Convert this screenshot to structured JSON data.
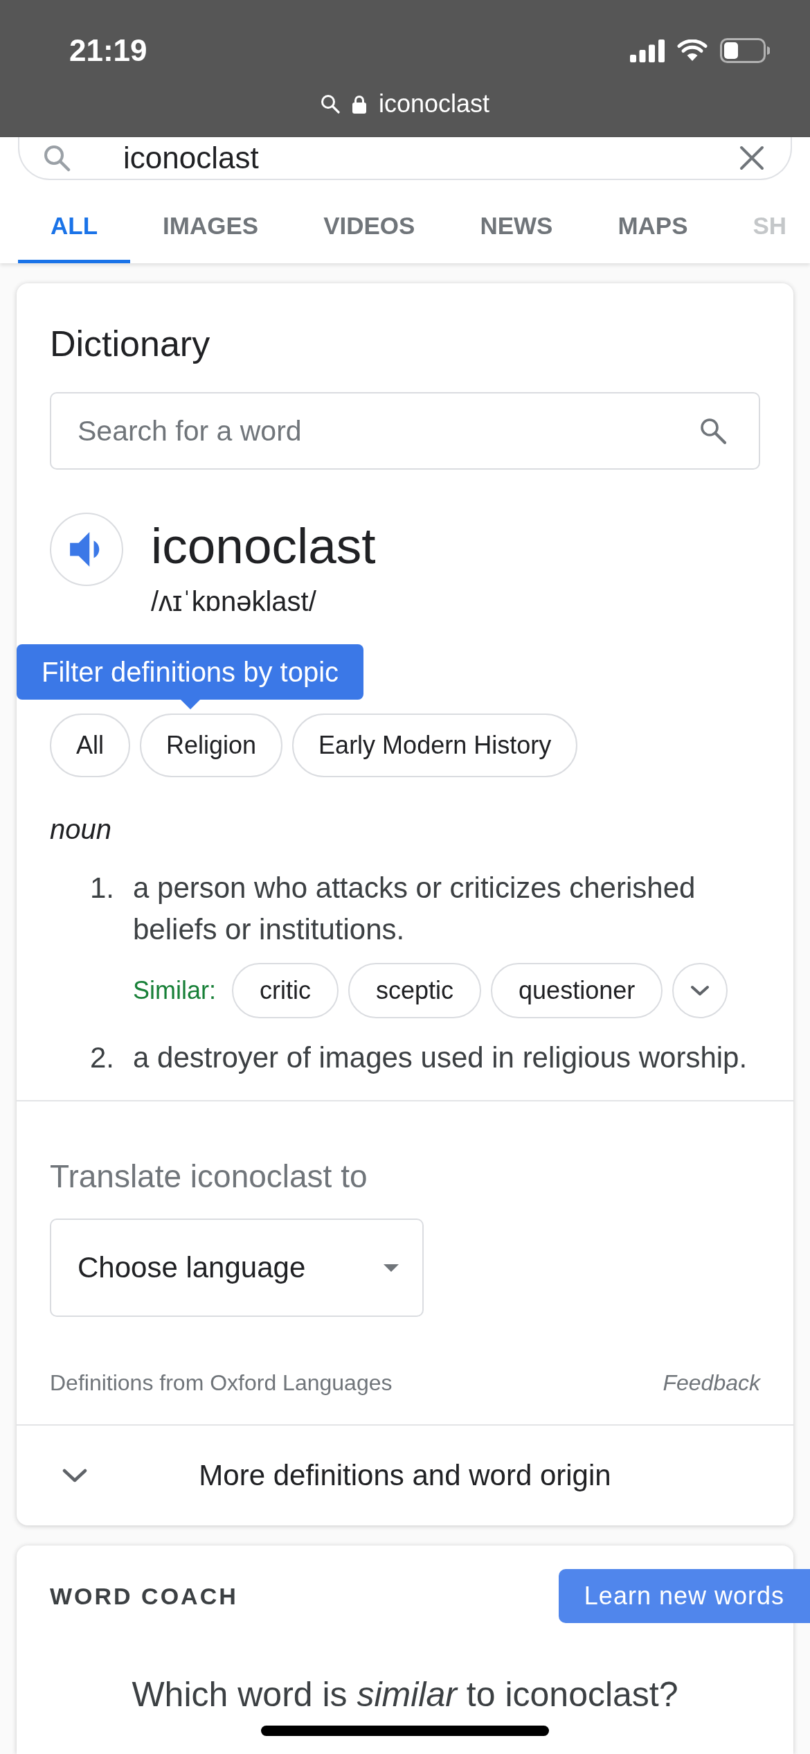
{
  "status_bar": {
    "time": "21:19"
  },
  "address_bar": {
    "url": "iconoclast"
  },
  "search": {
    "value": "iconoclast"
  },
  "tabs": [
    {
      "label": "ALL",
      "selected": true
    },
    {
      "label": "IMAGES",
      "selected": false
    },
    {
      "label": "VIDEOS",
      "selected": false
    },
    {
      "label": "NEWS",
      "selected": false
    },
    {
      "label": "MAPS",
      "selected": false
    },
    {
      "label": "SH",
      "selected": false
    }
  ],
  "dictionary": {
    "title": "Dictionary",
    "search": {
      "placeholder": "Search for a word"
    },
    "word": "iconoclast",
    "phonetic": "/ʌɪˈkɒnəklast/",
    "tooltip": "Filter definitions by topic",
    "topics": [
      "All",
      "Religion",
      "Early Modern History"
    ],
    "part_of_speech": "noun",
    "definitions": [
      {
        "number": "1.",
        "text": "a person who attacks or criticizes cherished beliefs or institutions.",
        "similar_label": "Similar:",
        "similar": [
          "critic",
          "sceptic",
          "questioner"
        ]
      },
      {
        "number": "2.",
        "text": "a destroyer of images used in religious worship."
      }
    ],
    "translate": {
      "label": "Translate iconoclast to",
      "dropdown": {
        "value": "Choose language"
      }
    },
    "source": "Definitions from Oxford Languages",
    "feedback": "Feedback",
    "more": "More definitions and word origin"
  },
  "word_coach": {
    "title": "WORD COACH",
    "button": "Learn new words",
    "question": "Which word is *similar* to iconoclast?"
  }
}
